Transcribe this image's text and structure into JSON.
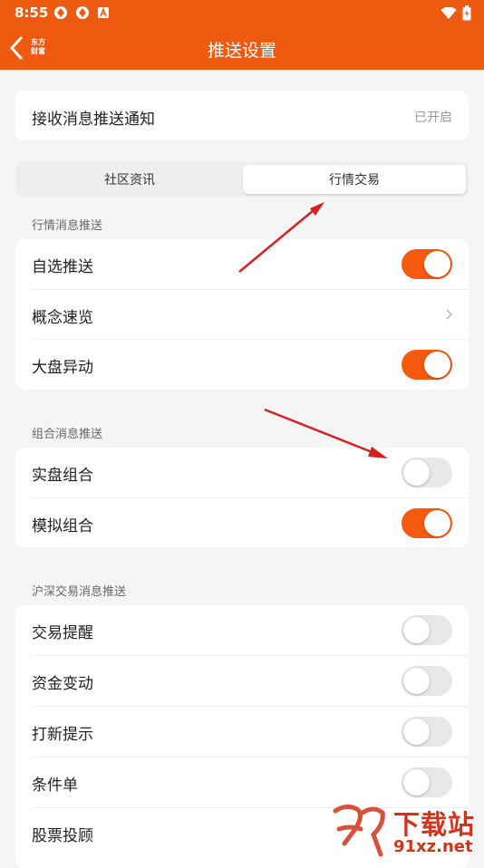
{
  "status_bar": {
    "time": "8:55"
  },
  "header": {
    "brand_line1": "东方",
    "brand_line2": "财富",
    "title": "推送设置"
  },
  "receive": {
    "label": "接收消息推送通知",
    "status": "已开启"
  },
  "tabs": [
    {
      "label": "社区资讯",
      "active": false
    },
    {
      "label": "行情交易",
      "active": true
    }
  ],
  "market": {
    "title": "行情消息推送",
    "items": [
      {
        "label": "自选推送",
        "on": true
      },
      {
        "label": "概念速览"
      },
      {
        "label": "大盘异动",
        "on": true
      }
    ]
  },
  "portfolio": {
    "title": "组合消息推送",
    "items": [
      {
        "label": "实盘组合",
        "on": false
      },
      {
        "label": "模拟组合",
        "on": true
      }
    ]
  },
  "trade": {
    "title": "沪深交易消息推送",
    "items": [
      {
        "label": "交易提醒",
        "on": false
      },
      {
        "label": "资金变动",
        "on": false
      },
      {
        "label": "打新提示",
        "on": false
      },
      {
        "label": "条件单",
        "on": false
      },
      {
        "label": "股票投顾"
      }
    ]
  },
  "watermark": {
    "text": "下载站",
    "domain": "91xz.net"
  },
  "colors": {
    "header": "#ee5a10",
    "toggle_on": "#f55a10",
    "toggle_off": "#e8e8e8",
    "annotation": "#d42020"
  }
}
